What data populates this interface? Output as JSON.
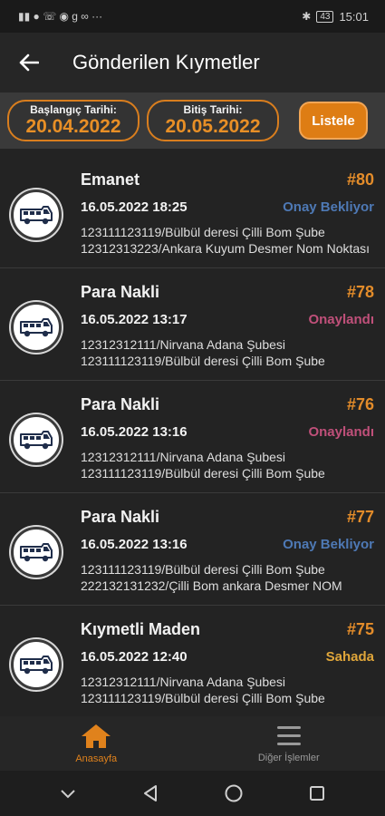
{
  "status_bar": {
    "left_glyphs": "▮▮ ● ☏ ◉ g ∞ ···",
    "time": "15:01",
    "battery": "43"
  },
  "header": {
    "title": "Gönderilen Kıymetler"
  },
  "filters": {
    "start_label": "Başlangıç Tarihi:",
    "start_value": "20.04.2022",
    "end_label": "Bitiş Tarihi:",
    "end_value": "20.05.2022",
    "list_button": "Listele"
  },
  "items": [
    {
      "type": "Emanet",
      "number": "#80",
      "datetime": "16.05.2022 18:25",
      "status": "Onay Bekliyor",
      "status_color": "#4e79b5",
      "line1": "123111123119/Bülbül deresi Çilli Bom Şube",
      "line2": "12312313223/Ankara Kuyum Desmer Nom Noktası"
    },
    {
      "type": "Para Nakli",
      "number": "#78",
      "datetime": "16.05.2022 13:17",
      "status": "Onaylandı",
      "status_color": "#c0507a",
      "line1": "12312312111/Nirvana Adana Şubesi",
      "line2": "123111123119/Bülbül deresi Çilli Bom Şube"
    },
    {
      "type": "Para Nakli",
      "number": "#76",
      "datetime": "16.05.2022 13:16",
      "status": "Onaylandı",
      "status_color": "#c0507a",
      "line1": "12312312111/Nirvana Adana Şubesi",
      "line2": "123111123119/Bülbül deresi Çilli Bom Şube"
    },
    {
      "type": "Para Nakli",
      "number": "#77",
      "datetime": "16.05.2022 13:16",
      "status": "Onay Bekliyor",
      "status_color": "#4e79b5",
      "line1": "123111123119/Bülbül deresi Çilli Bom Şube",
      "line2": "222132131232/Çilli Bom ankara Desmer NOM"
    },
    {
      "type": "Kıymetli Maden",
      "number": "#75",
      "datetime": "16.05.2022 12:40",
      "status": "Sahada",
      "status_color": "#e0a63a",
      "line1": "12312312111/Nirvana Adana Şubesi",
      "line2": "123111123119/Bülbül deresi Çilli Bom Şube"
    }
  ],
  "bottom_nav": {
    "home_label": "Anasayfa",
    "home_color": "#e0821c",
    "other_label": "Diğer İşlemler",
    "other_color": "#9a9a9a"
  },
  "icons": {
    "back": "back-arrow-icon",
    "vehicle": "armored-truck-icon",
    "home": "home-icon",
    "menu": "hamburger-menu-icon"
  }
}
